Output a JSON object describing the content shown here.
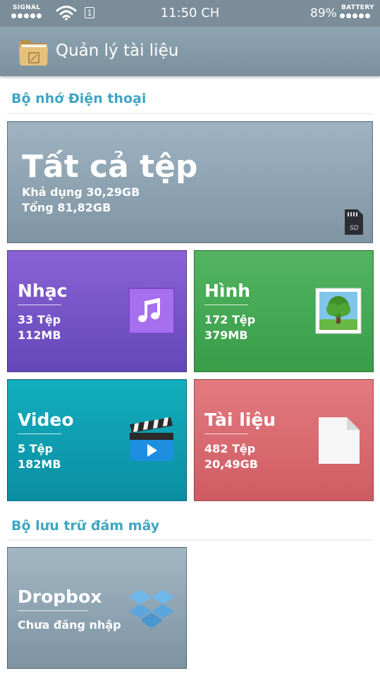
{
  "status_bar": {
    "signal_label": "SIGNAL",
    "sim_slot": "1",
    "time": "11:50 CH",
    "battery_percent": "89%",
    "battery_label": "BATTERY"
  },
  "app_bar": {
    "title": "Quản lý tài liệu"
  },
  "phone_storage": {
    "section_title": "Bộ nhớ Điện thoại",
    "all_files": {
      "title": "Tất cả tệp",
      "available": "Khả dụng 30,29GB",
      "total": "Tổng 81,82GB"
    },
    "categories": [
      {
        "name": "Nhạc",
        "count": "33 Tệp",
        "size": "112MB",
        "icon": "music-note-icon",
        "color": "#7856c9"
      },
      {
        "name": "Hình",
        "count": "172 Tệp",
        "size": "379MB",
        "icon": "tree-picture-icon",
        "color": "#45a854"
      },
      {
        "name": "Video",
        "count": "5 Tệp",
        "size": "182MB",
        "icon": "clapperboard-icon",
        "color": "#0f9fb1"
      },
      {
        "name": "Tài liệu",
        "count": "482 Tệp",
        "size": "20,49GB",
        "icon": "document-icon",
        "color": "#d96a70"
      }
    ]
  },
  "cloud_storage": {
    "section_title": "Bộ lưu trữ đám mây",
    "dropbox": {
      "name": "Dropbox",
      "status": "Chưa đăng nhập",
      "icon": "dropbox-icon"
    }
  }
}
